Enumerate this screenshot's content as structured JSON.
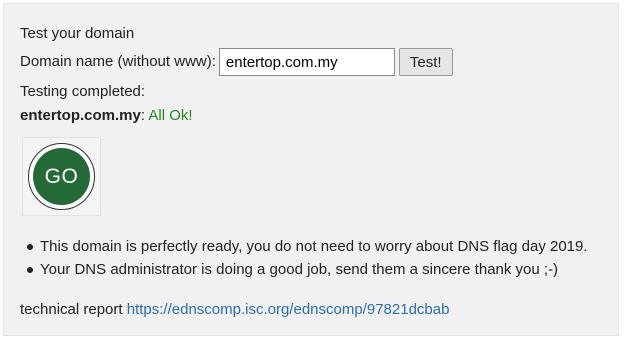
{
  "form": {
    "heading": "Test your domain",
    "domain_label": "Domain name (without www):",
    "domain_value": "entertop.com.my",
    "test_button": "Test!"
  },
  "result": {
    "status_line": "Testing completed:",
    "domain": "entertop.com.my",
    "separator": ":",
    "verdict": "All Ok!",
    "verdict_color": "#1f8a1f",
    "badge_text": "GO",
    "badge_color": "#246a37"
  },
  "notes": [
    "This domain is perfectly ready, you do not need to worry about DNS flag day 2019.",
    "Your DNS administrator is doing a good job, send them a sincere thank you ;-)"
  ],
  "report": {
    "label": "technical report",
    "link_text": "https://ednscomp.isc.org/ednscomp/97821dcbab"
  }
}
